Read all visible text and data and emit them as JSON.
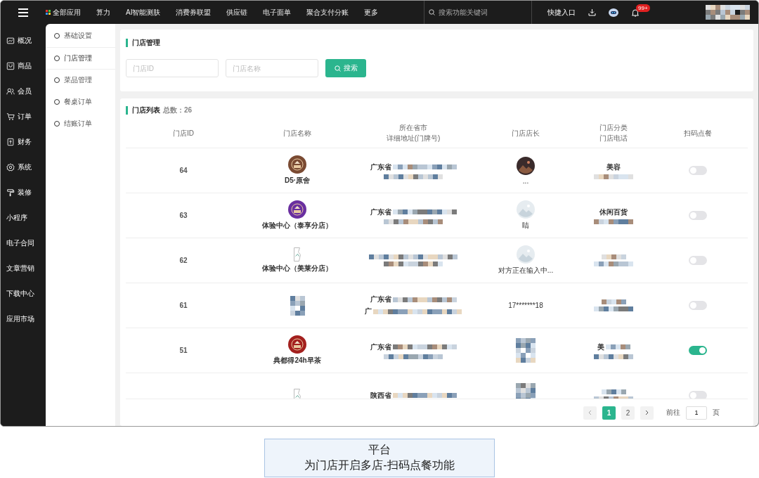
{
  "topbar": {
    "apps_label": "全部应用",
    "nav": [
      "算力",
      "AI智能测肤",
      "消费券联盟",
      "供应链",
      "电子面单",
      "聚合支付分账",
      "更多"
    ],
    "search": {
      "placeholder": "搜索功能关键词"
    },
    "shortcut": "快捷入口",
    "badge": "99+"
  },
  "sidebar": {
    "items": [
      {
        "label": "概况",
        "icon": true
      },
      {
        "label": "商品",
        "icon": true
      },
      {
        "label": "会员",
        "icon": true
      },
      {
        "label": "订单",
        "icon": true
      },
      {
        "label": "财务",
        "icon": true
      },
      {
        "label": "系统",
        "icon": true
      },
      {
        "label": "装修",
        "icon": true
      },
      {
        "label": "小程序",
        "icon": false
      },
      {
        "label": "电子合同",
        "icon": false
      },
      {
        "label": "文章营销",
        "icon": false
      },
      {
        "label": "下载中心",
        "icon": false
      },
      {
        "label": "应用市场",
        "icon": false
      }
    ]
  },
  "subnav": {
    "items": [
      {
        "label": "基础设置",
        "selected": false
      },
      {
        "label": "门店管理",
        "selected": true
      },
      {
        "label": "菜品管理",
        "selected": false
      },
      {
        "label": "餐桌订单",
        "selected": false
      },
      {
        "label": "结账订单",
        "selected": false
      }
    ]
  },
  "filter": {
    "title": "门店管理",
    "fields": [
      {
        "placeholder": "门店ID"
      },
      {
        "placeholder": "门店名称"
      }
    ],
    "search_button": "搜索"
  },
  "table": {
    "title": "门店列表",
    "total_label": "总数：",
    "total": "26",
    "columns": [
      [
        "门店ID"
      ],
      [
        "门店名称"
      ],
      [
        "所在省市",
        "详细地址(门牌号)"
      ],
      [
        "门店店长"
      ],
      [
        "门店分类",
        "门店电话"
      ],
      [
        "扫码点餐"
      ]
    ],
    "rows": [
      {
        "id": "64",
        "name": "D5·原舍",
        "address": "广东省",
        "address_line2": "",
        "manager": "...",
        "category": "美容",
        "scan_order": false
      },
      {
        "id": "63",
        "name": "体验中心（泰享分店）",
        "address": "广东省",
        "address_line2": "",
        "manager": "睛",
        "category": "休闲百货",
        "scan_order": false
      },
      {
        "id": "62",
        "logo": {
          "kind": "broken"
        },
        "name": "体验中心（美莱分店）",
        "address": "",
        "address_line2": "",
        "manager": "对方正在输入中...",
        "category": "",
        "scan_order": false
      },
      {
        "id": "61",
        "logo": {
          "kind": "blurred"
        },
        "name": "",
        "address": "广东省",
        "address_line2": "广",
        "manager": "17*******18",
        "category": "",
        "scan_order": false
      },
      {
        "id": "51",
        "name": "典都得24h早茶",
        "address": "广东省",
        "address_line2": "",
        "manager_avatar": {
          "kind": "blurred"
        },
        "manager": "",
        "category": "美",
        "scan_order": true
      },
      {
        "id": "",
        "logo": {
          "kind": "broken"
        },
        "name": "",
        "address": "陕西省",
        "address_line2": "",
        "manager_avatar": {
          "kind": "blurred"
        },
        "manager": "",
        "category": "",
        "scan_order": false
      }
    ]
  },
  "pagination": {
    "pages": [
      {
        "label": "1",
        "selected": true
      },
      {
        "label": "2",
        "selected": false
      }
    ],
    "goto_label": "前往",
    "goto_value": "1",
    "page_suffix": "页"
  },
  "caption": {
    "lines": [
      "平台",
      "为门店开启多店-扫码点餐功能"
    ]
  }
}
